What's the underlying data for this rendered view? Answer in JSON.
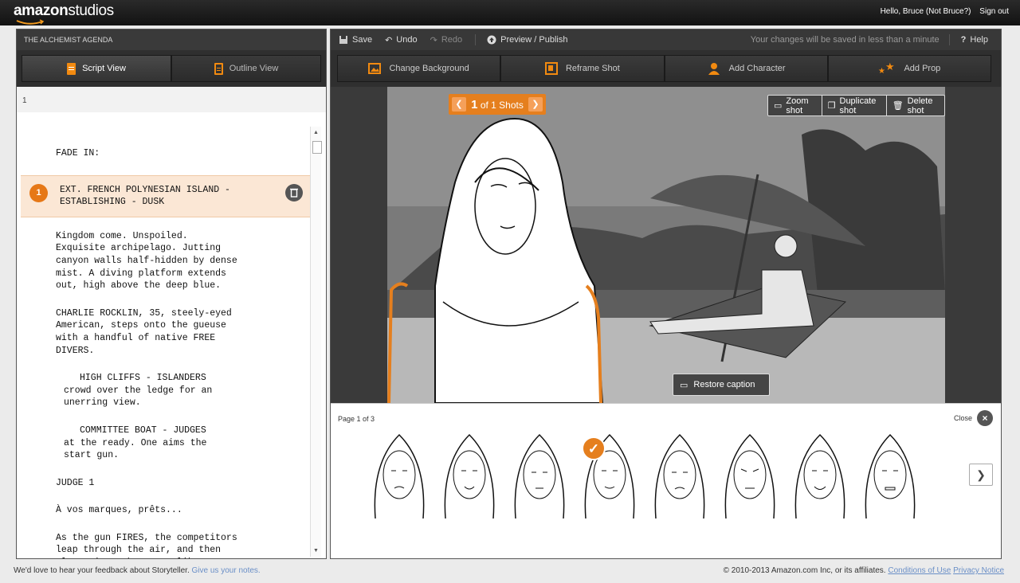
{
  "header": {
    "logo_text_bold": "amazon",
    "logo_text_light": "studios",
    "greeting": "Hello, Bruce (Not Bruce?)",
    "sign_out": "Sign out"
  },
  "left_panel": {
    "project_title": "THE ALCHEMIST AGENDA",
    "tabs": [
      {
        "label": "Script View",
        "active": true
      },
      {
        "label": "Outline View",
        "active": false
      }
    ],
    "page_number": "1",
    "script": {
      "fade_in": "FADE IN:",
      "scene_heading": {
        "number": "1",
        "text": "EXT. FRENCH POLYNESIAN ISLAND -\nESTABLISHING - DUSK"
      },
      "action1": "Kingdom come. Unspoiled.\nExquisite archipelago. Jutting\ncanyon walls half-hidden by dense\nmist. A diving platform extends\nout, high above the deep blue.",
      "action2": "CHARLIE ROCKLIN, 35, steely-eyed\nAmerican, steps onto the gueuse\nwith a handful of native FREE\nDIVERS.",
      "sub1_head": "HIGH CLIFFS - ISLANDERS",
      "sub1_body": "crowd over the ledge for an\nunerring view.",
      "sub2_head": "COMMITTEE BOAT - JUDGES",
      "sub2_body": "at the ready. One aims the\nstart gun.",
      "character": "JUDGE 1",
      "dialogue": "À vos marques, prêts...",
      "action3": "As the gun FIRES, the competitors\nleap through the air, and then\nplunge into the water like\nharpoons."
    }
  },
  "toolbar": {
    "save": "Save",
    "undo": "Undo",
    "redo": "Redo",
    "preview": "Preview / Publish",
    "autosave_msg": "Your changes will be saved in less than a minute",
    "help": "Help"
  },
  "actions": {
    "change_background": "Change Background",
    "reframe_shot": "Reframe Shot",
    "add_character": "Add Character",
    "add_prop": "Add Prop"
  },
  "stage": {
    "shot_current": "1",
    "shot_total_label": "of 1 Shots",
    "zoom_shot": "Zoom shot",
    "duplicate_shot": "Duplicate shot",
    "delete_shot": "Delete shot",
    "restore_caption": "Restore caption"
  },
  "expressions": {
    "page_label": "Page 1 of 3",
    "close": "Close",
    "selected_index": 3,
    "count": 8
  },
  "footer": {
    "feedback": "We'd love to hear your feedback about Storyteller.",
    "feedback_link": "Give us your notes.",
    "copyright": "© 2010-2013 Amazon.com Inc, or its affiliates.",
    "conditions": "Conditions of Use",
    "privacy": "Privacy Notice"
  },
  "colors": {
    "accent": "#e57f1e",
    "scene_highlight": "#fbe7d5",
    "toolbar_bg": "#2f2f2f"
  }
}
